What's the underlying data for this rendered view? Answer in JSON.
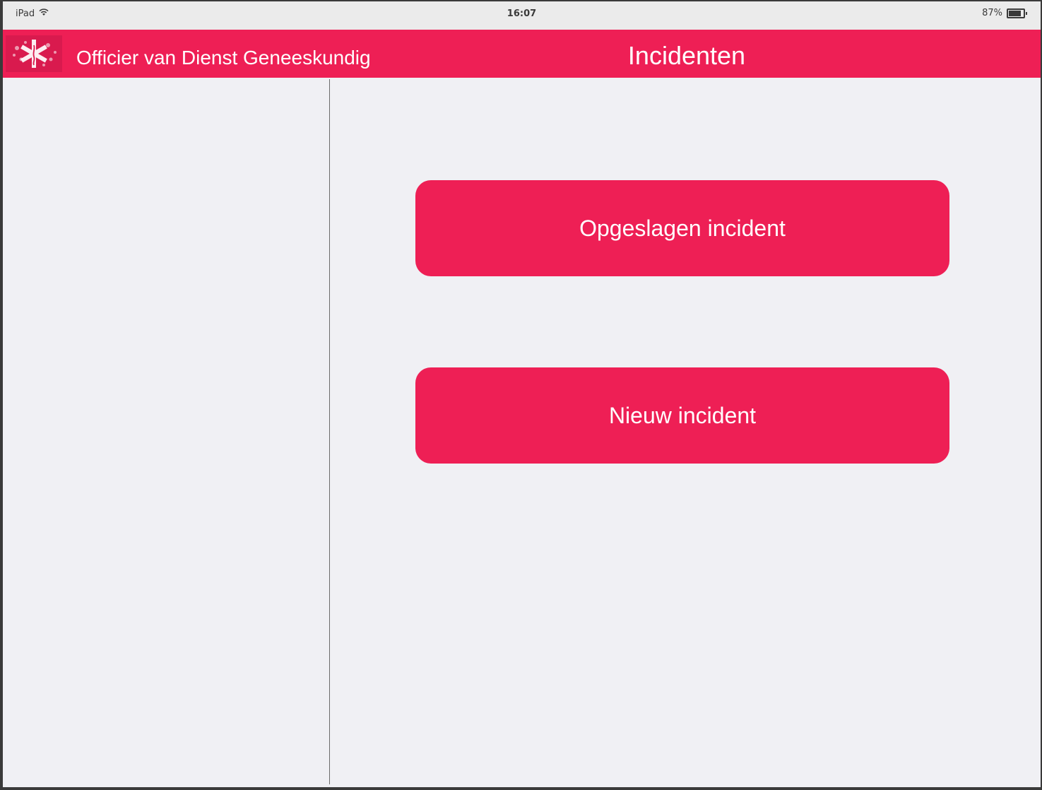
{
  "status_bar": {
    "device": "iPad",
    "time": "16:07",
    "battery_text": "87%",
    "battery_level": 0.87,
    "wifi_icon": "wifi-icon"
  },
  "header": {
    "app_title": "Officier van Dienst Geneeskundig",
    "page_title": "Incidenten",
    "logo_icon": "star-of-life-logo"
  },
  "main": {
    "buttons": [
      {
        "label": "Opgeslagen incident"
      },
      {
        "label": "Nieuw incident"
      }
    ]
  },
  "colors": {
    "accent": "#ee1f55",
    "background": "#f0f0f4",
    "divider": "#6b6b6b"
  }
}
